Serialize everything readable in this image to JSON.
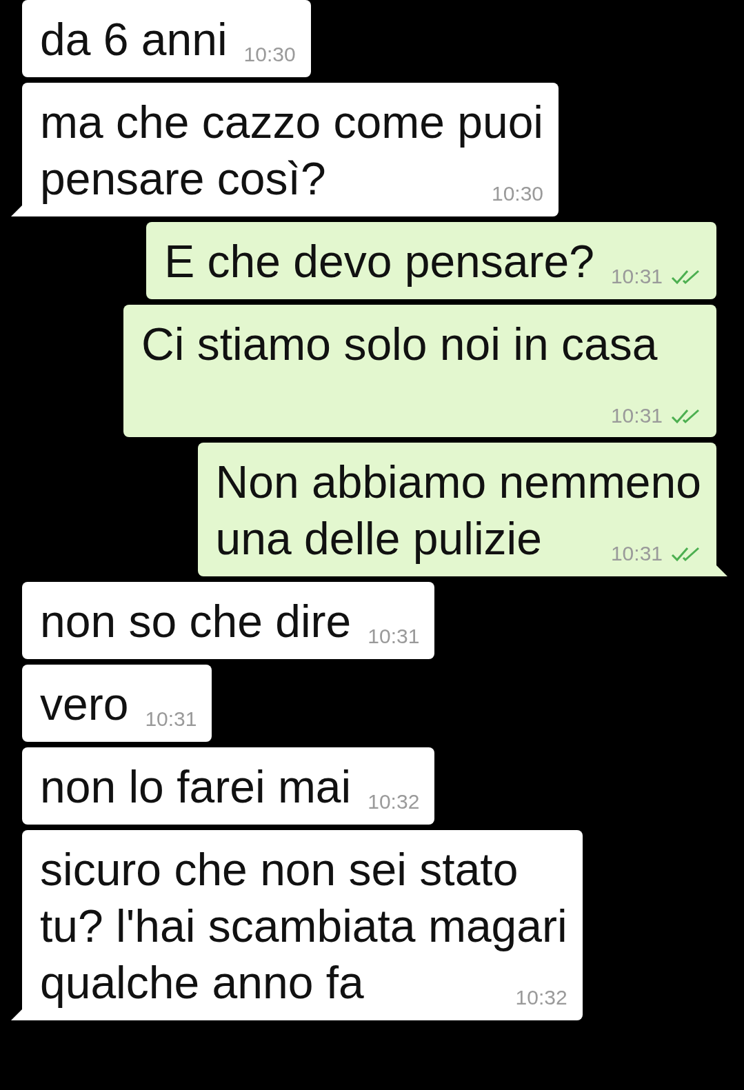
{
  "messages": [
    {
      "kind": "received",
      "lines": [
        "da 6 anni"
      ],
      "time": "10:30",
      "tail": false
    },
    {
      "kind": "received",
      "lines": [
        "ma che cazzo come puoi",
        "pensare così?"
      ],
      "time": "10:30",
      "tail": true
    },
    {
      "kind": "sent",
      "lines": [
        "E che devo pensare?"
      ],
      "time": "10:31",
      "tail": false,
      "read": true
    },
    {
      "kind": "sent",
      "lines": [
        "Ci stiamo solo noi in casa"
      ],
      "time": "10:31",
      "tail": false,
      "read": true
    },
    {
      "kind": "sent",
      "lines": [
        "Non abbiamo nemmeno",
        "una delle pulizie"
      ],
      "time": "10:31",
      "tail": true,
      "read": true
    },
    {
      "kind": "received",
      "lines": [
        "non so che dire"
      ],
      "time": "10:31",
      "tail": false
    },
    {
      "kind": "received",
      "lines": [
        "vero"
      ],
      "time": "10:31",
      "tail": false
    },
    {
      "kind": "received",
      "lines": [
        "non lo farei mai"
      ],
      "time": "10:32",
      "tail": false
    },
    {
      "kind": "received",
      "lines": [
        "sicuro che non sei stato",
        "tu? l'hai scambiata magari",
        "qualche anno fa"
      ],
      "time": "10:32",
      "tail": true
    }
  ]
}
